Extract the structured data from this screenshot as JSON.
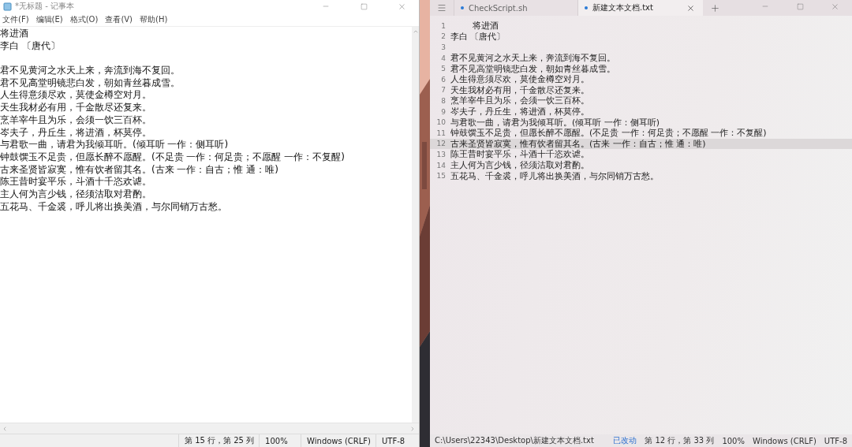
{
  "notepad": {
    "title": "*无标题 - 记事本",
    "menu": [
      "文件(F)",
      "编辑(E)",
      "格式(O)",
      "查看(V)",
      "帮助(H)"
    ],
    "paragraphs": [
      [
        "将进酒",
        "李白 〔唐代〕"
      ],
      [
        "君不见黄河之水天上来，奔流到海不复回。",
        "君不见高堂明镜悲白发，朝如青丝暮成雪。",
        "人生得意须尽欢，莫使金樽空对月。",
        "天生我材必有用，千金散尽还复来。",
        "烹羊宰牛且为乐，会须一饮三百杯。",
        "岑夫子，丹丘生，将进酒，杯莫停。",
        "与君歌一曲，请君为我倾耳听。(倾耳听 一作：侧耳听)",
        "钟鼓馔玉不足贵，但愿长醉不愿醒。(不足贵 一作：何足贵；不愿醒 一作：不复醒)",
        "古来圣贤皆寂寞，惟有饮者留其名。(古来 一作：自古；惟 通：唯)",
        "陈王昔时宴平乐，斗酒十千恣欢谑。",
        "主人何为言少钱，径须沽取对君酌。",
        "五花马、千金裘，呼儿将出换美酒，与尔同销万古愁。"
      ]
    ],
    "status": [
      "第 15 行，第 25 列",
      "100%",
      "Windows (CRLF)",
      "UTF-8"
    ]
  },
  "editor": {
    "tabs": [
      {
        "label": "CheckScript.sh",
        "selected": false,
        "modified": true
      },
      {
        "label": "新建文本文档.txt",
        "selected": true,
        "modified": true
      }
    ],
    "lines": [
      {
        "number": "1",
        "text": "        将进酒",
        "current": false
      },
      {
        "number": "2",
        "text": "李白 〔唐代〕",
        "current": false
      },
      {
        "number": "3",
        "current": false
      },
      {
        "number": "4",
        "text": "君不见黄河之水天上来，奔流到海不复回。",
        "current": false
      },
      {
        "number": "5",
        "text": "君不见高堂明镜悲白发，朝如青丝暮成雪。",
        "current": false
      },
      {
        "number": "6",
        "text": "人生得意须尽欢，莫使金樽空对月。",
        "current": false
      },
      {
        "number": "7",
        "text": "天生我材必有用，千金散尽还复来。",
        "current": false
      },
      {
        "number": "8",
        "text": "烹羊宰牛且为乐，会须一饮三百杯。",
        "current": false
      },
      {
        "number": "9",
        "text": "岑夫子，丹丘生，将进酒，杯莫停。",
        "current": false
      },
      {
        "number": "10",
        "text": "与君歌一曲，请君为我倾耳听。(倾耳听 一作：侧耳听)",
        "current": false
      },
      {
        "number": "11",
        "text": "钟鼓馔玉不足贵，但愿长醉不愿醒。(不足贵 一作：何足贵；不愿醒 一作：不复醒)",
        "current": false
      },
      {
        "number": "12",
        "text": "古来圣贤皆寂寞，惟有饮者留其名。(古来 一作：自古；惟 通：唯)",
        "current": true
      },
      {
        "number": "13",
        "text": "陈王昔时宴平乐，斗酒十千恣欢谑。",
        "current": false
      },
      {
        "number": "14",
        "text": "主人何为言少钱，径须沽取对君酌。",
        "current": false
      },
      {
        "number": "15",
        "text": "五花马、千金裘，呼儿将出换美酒，与尔同销万古愁。",
        "current": false
      }
    ],
    "status": {
      "path": "C:\\Users\\22343\\Desktop\\新建文本文档.txt",
      "modified": "已改动",
      "items": [
        "第 12 行，第 33 列",
        "100%",
        "Windows (CRLF)",
        "UTF-8"
      ]
    }
  }
}
